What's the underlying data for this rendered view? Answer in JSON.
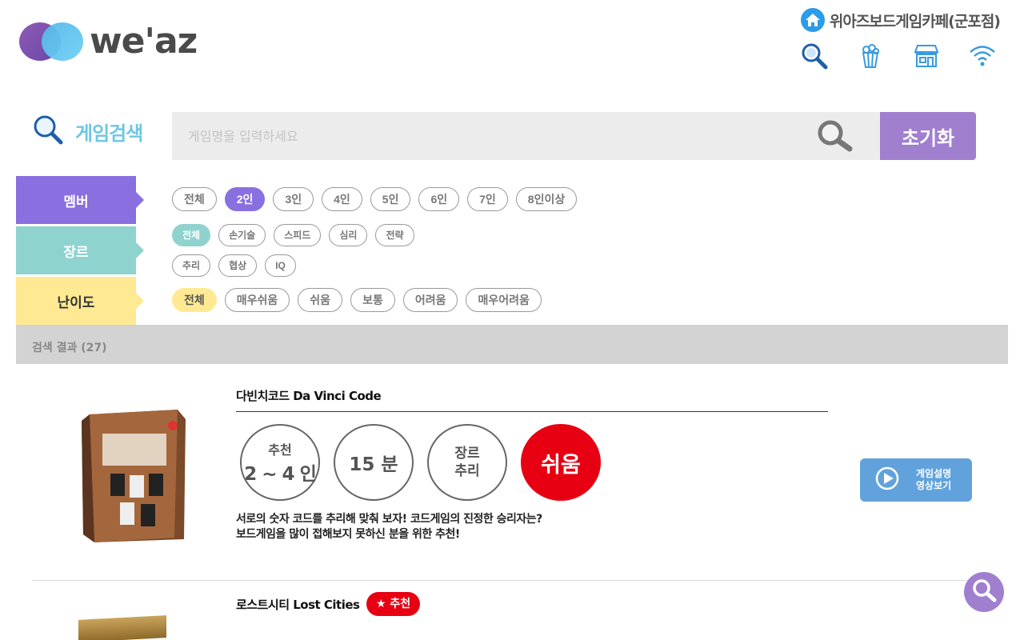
{
  "header": {
    "logo_text": "we'az",
    "store_name": "위아즈보드게임카페(군포점)",
    "icons": [
      "search-icon",
      "popcorn-icon",
      "store-icon",
      "wifi-icon"
    ]
  },
  "search": {
    "label": "게임검색",
    "placeholder": "게임명을 입력하세요",
    "reset_label": "초기화"
  },
  "filters": {
    "member": {
      "label": "멤버",
      "options": [
        "전체",
        "2인",
        "3인",
        "4인",
        "5인",
        "6인",
        "7인",
        "8인이상"
      ],
      "selected": "2인"
    },
    "genre": {
      "label": "장르",
      "options_row1": [
        "전체",
        "손기술",
        "스피드",
        "심리",
        "전략"
      ],
      "options_row2": [
        "추리",
        "협상",
        "IQ"
      ],
      "selected": "전체"
    },
    "level": {
      "label": "난이도",
      "options": [
        "전체",
        "매우쉬움",
        "쉬움",
        "보통",
        "어려움",
        "매우어려움"
      ],
      "selected": "전체"
    }
  },
  "results": {
    "summary": "검색 결과 (27)"
  },
  "games": [
    {
      "title": "다빈치코드 Da Vinci Code",
      "players_label": "추천",
      "players": "2 ~ 4 인",
      "time": "15 분",
      "genre_label": "장르",
      "genre": "추리",
      "level": "쉬움",
      "desc_line1": "서로의 숫자 코드를 추리해 맞춰 보자!  코드게임의 진정한 승리자는?",
      "desc_line2": "보드게임을 많이 접해보지 못하신 분을 위한 추천!",
      "video_line1": "게임설명",
      "video_line2": "영상보기"
    },
    {
      "title": "로스트시티 Lost Cities",
      "badge": "★ 추천"
    }
  ],
  "colors": {
    "member": "#8a6fe0",
    "genre": "#8fd3cf",
    "level": "#ffea93",
    "reset": "#a07fcf",
    "level_easy": "#e60012",
    "video": "#62a2dc"
  }
}
